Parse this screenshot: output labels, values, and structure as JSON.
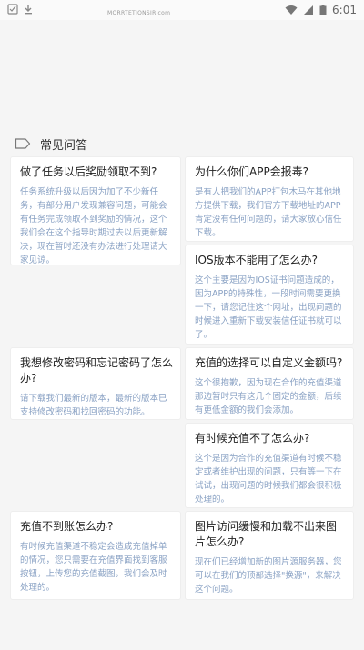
{
  "status_bar": {
    "time": "6:01",
    "icons": [
      "notification-icon",
      "download-icon",
      "wifi-icon",
      "signal-icon",
      "battery-icon"
    ]
  },
  "header": {
    "partial_text": "MORRTETIONSIR.com"
  },
  "section": {
    "title": "常见问答",
    "icon": "tag-icon"
  },
  "faq": [
    {
      "question": "做了任务以后奖励领取不到?",
      "answer": "任务系统升级以后因为加了不少新任务，有部分用户发现兼容问题，可能会有任务完成领取不到奖励的情况，这个我们会在这个指导时期过去以后更新解决，现在暂时还没有办法进行处理请大家见谅。"
    },
    {
      "question": "为什么你们APP会报毒?",
      "answer": "是有人把我们的APP打包木马在其他地方提供下载，我们官方下载地址的APP肯定没有任何问题的，请大家放心信任下载。"
    },
    {
      "question": "IOS版本不能用了怎么办?",
      "answer": "这个主要是因为IOS证书问题造成的，因为APP的特殊性，一段时间需要更换一下，请您记住这个网址，出现问题的时候进入重新下载安装信任证书就可以了。"
    },
    {
      "question": "我想修改密码和忘记密码了怎么办?",
      "answer": "请下载我们最新的版本，最新的版本已支持修改密码和找回密码的功能。"
    },
    {
      "question": "充值的选择可以自定义金额吗?",
      "answer": "这个很抱歉，因为现在合作的充值渠道那边暂时只有这几个固定的金额，后续有更低金额的我们会添加。"
    },
    {
      "question": "有时候充值不了怎么办?",
      "answer": "这个是因为合作的充值渠道有时候不稳定或者维护出现的问题，只有等一下在试试，出现问题的时候我们都会很积极处理的。"
    },
    {
      "question": "充值不到账怎么办?",
      "answer": "有时候充值渠道不稳定会造成充值掉单的情况，您只需要在充值界面找到客服按钮，上传您的充值截图，我们会及时处理的。"
    },
    {
      "question": "图片访问缓慢和加载不出来图片怎么办?",
      "answer": "现在们已经增加新的图片源服务器，您可以在我们的顶部选择\"换源\"，来解决这个问题。"
    }
  ]
}
